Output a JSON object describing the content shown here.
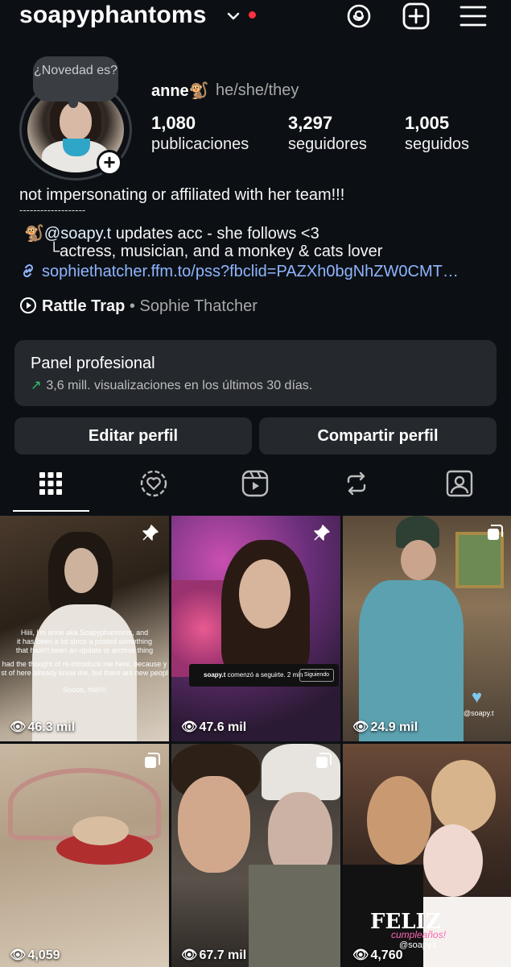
{
  "header": {
    "username": "soapyphantoms",
    "icons": [
      "chevron-down-icon",
      "threads-icon",
      "create-icon",
      "menu-icon"
    ],
    "notification_color": "#ff3040"
  },
  "profile": {
    "note": "¿Novedad es?",
    "name": "anne🐒",
    "pronouns": "he/she/they",
    "stats": [
      {
        "value": "1,080",
        "label": "publicaciones"
      },
      {
        "value": "3,297",
        "label": "seguidores"
      },
      {
        "value": "1,005",
        "label": "seguidos"
      }
    ]
  },
  "bio": {
    "line1": "not impersonating or affiliated with her team!!!",
    "line2": "-------------------",
    "line3_emoji": "🐒",
    "line3_mention": "@soapy.t",
    "line3_rest": " updates acc - she follows <3",
    "line4": "└actress, musician, and a monkey & cats lover",
    "link": "sophiethatcher.ffm.to/pss?fbclid=PAZXh0bgNhZW0CMT…",
    "music_title": "Rattle Trap",
    "music_sep": " • ",
    "music_artist": "Sophie Thatcher"
  },
  "panel": {
    "title": "Panel profesional",
    "subtitle": "3,6 mill. visualizaciones en los últimos 30 días."
  },
  "buttons": {
    "edit": "Editar perfil",
    "share": "Compartir perfil"
  },
  "tabs": [
    "grid-icon",
    "collab-icon",
    "reels-icon",
    "reposts-icon",
    "tagged-icon"
  ],
  "posts": [
    {
      "views": "46.3 mil",
      "badge": "pin-icon"
    },
    {
      "views": "47.6 mil",
      "badge": "pin-icon"
    },
    {
      "views": "24.9 mil",
      "badge": "multi-icon"
    },
    {
      "views": "4,059",
      "badge": "multi-icon"
    },
    {
      "views": "67.7 mil",
      "badge": "multi-icon"
    },
    {
      "views": "4,760",
      "badge": ""
    }
  ],
  "post_text": {
    "p1_line1": "Hiiii, I'm anne aka Soapyphantoms, and",
    "p1_line2": "it has been a lot since a posted something",
    "p1_line3": "that hasn't been an update or archive thing",
    "p1_line4": "had the thought of re-introduce me here, because y",
    "p1_line5": "st of here already know me, but there are new peopl",
    "p1_line6": "Soooo, hiiii!!!!",
    "p2_handle": "soapy.t",
    "p2_text": " comenzó a seguirte. 2 min",
    "p2_button": "Siguiendo",
    "p3_tag": "@soapy.t",
    "p6_feliz": "FELIZ",
    "p6_cumple": "cumpleaños!",
    "p6_tag": "@soapy.t"
  }
}
